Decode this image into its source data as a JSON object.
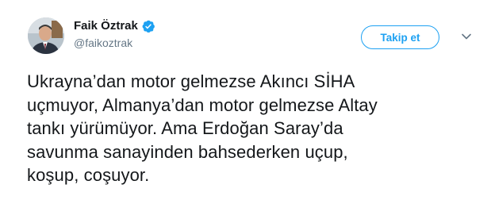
{
  "author": {
    "display_name": "Faik Öztrak",
    "handle": "@faikoztrak",
    "verified": true,
    "avatar_icon": "profile-photo"
  },
  "actions": {
    "follow_label": "Takip et",
    "more_icon": "chevron-down-icon"
  },
  "tweet": {
    "lines": [
      "Ukrayna’dan motor gelmezse Akıncı SİHA",
      "uçmuyor, Almanya’dan motor gelmezse Altay",
      "tankı yürümüyor. Ama Erdoğan Saray’da",
      "savunma sanayinden bahsederken uçup,",
      "koşup, coşuyor."
    ]
  },
  "colors": {
    "accent": "#1da1f2",
    "text": "#14171a",
    "secondary": "#657786"
  }
}
